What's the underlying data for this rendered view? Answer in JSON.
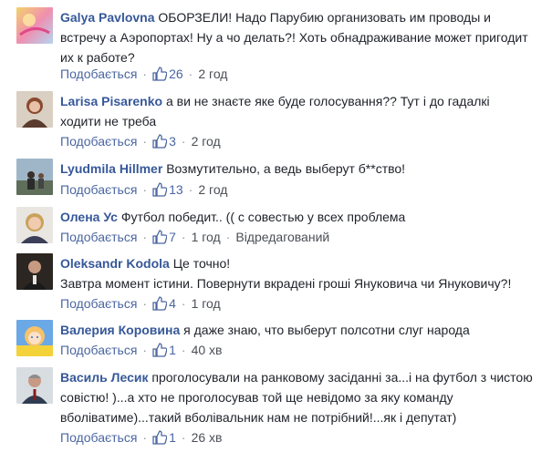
{
  "like_action": "Подобається",
  "comments": [
    {
      "author": "Galya Pavlovna",
      "text": "ОБОРЗЕЛИ! Надо Парубию организовать им проводы и встречу а Аэропортах! Ну а чо делать?! Хоть обнадраживание может пригодит их к работе?",
      "likes": "26",
      "time": "2 год",
      "edited": ""
    },
    {
      "author": "Larisa Pisarenko",
      "text": "а ви не знаєте яке буде голосування?? Тут і до гадалкі ходити не треба",
      "likes": "3",
      "time": "2 год",
      "edited": ""
    },
    {
      "author": "Lyudmila Hillmer",
      "text": "Возмутительно, а ведь выберут б**ство!",
      "likes": "13",
      "time": "2 год",
      "edited": ""
    },
    {
      "author": "Олена Ус",
      "text": "Футбол победит.. (( с совестью у всех проблема",
      "likes": "7",
      "time": "1 год",
      "edited": "Відредагований"
    },
    {
      "author": "Oleksandr Kodola",
      "text": "Це точно!",
      "text2": "Завтра момент істини. Повернути вкрадені гроші Януковича чи Януковичу?!",
      "likes": "4",
      "time": "1 год",
      "edited": ""
    },
    {
      "author": "Валерия Коровина",
      "text": "я даже знаю, что выберут полсотни слуг народа",
      "likes": "1",
      "time": "40 хв",
      "edited": ""
    },
    {
      "author": "Василь Лесик",
      "text": "проголосували на ранковому засіданні за...і на футбол з чистою совістю! )...а хто не проголосував той ще невідомо за яку команду вболіватиме)...такий вболівальник нам не потрібний!...як і депутат)",
      "likes": "1",
      "time": "26 хв",
      "edited": ""
    }
  ]
}
